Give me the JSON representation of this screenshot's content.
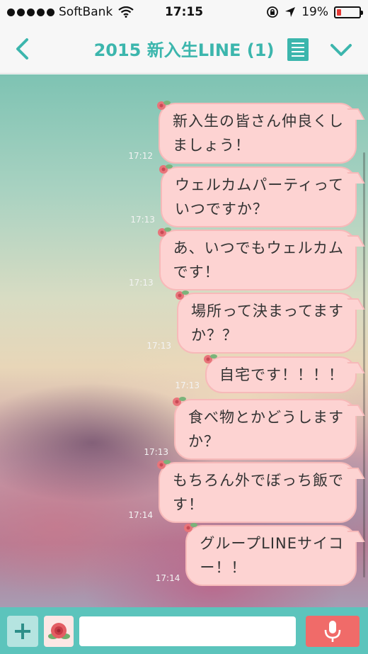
{
  "status_bar": {
    "carrier": "SoftBank",
    "time": "17:15",
    "battery_percent": "19%",
    "battery_level": 0.19
  },
  "header": {
    "title": "2015 新入生LINE (1)"
  },
  "messages": [
    {
      "time": "17:12",
      "lines": [
        "新入生の皆さん仲良くし",
        "ましょう！"
      ]
    },
    {
      "time": "17:13",
      "lines": [
        "ウェルカムパーティって",
        "いつですか？"
      ]
    },
    {
      "time": "17:13",
      "lines": [
        "あ、いつでもウェルカム",
        "です！"
      ]
    },
    {
      "time": "17:13",
      "lines": [
        "場所って決まってます",
        "か？？"
      ]
    },
    {
      "time": "17:13",
      "lines": [
        "自宅です！！！！"
      ]
    },
    {
      "time": "17:13",
      "lines": [
        "食べ物とかどうします",
        "か？"
      ]
    },
    {
      "time": "17:14",
      "lines": [
        "もちろん外でぼっち飯で",
        "す！"
      ]
    },
    {
      "time": "17:14",
      "lines": [
        "グループLINEサイコ",
        "ー！！"
      ]
    }
  ],
  "input": {
    "placeholder": "",
    "value": ""
  },
  "colors": {
    "accent": "#3cb6ad",
    "bubble": "#fdd3d2",
    "input_bar": "#5cc4bc",
    "mic": "#f06b69",
    "battery": "#e53935"
  },
  "icons": [
    "back-chevron-icon",
    "note-icon",
    "chevron-down-icon",
    "plus-icon",
    "flower-sticker-icon",
    "microphone-icon",
    "wifi-icon",
    "lock-rotation-icon",
    "location-arrow-icon",
    "battery-icon"
  ]
}
